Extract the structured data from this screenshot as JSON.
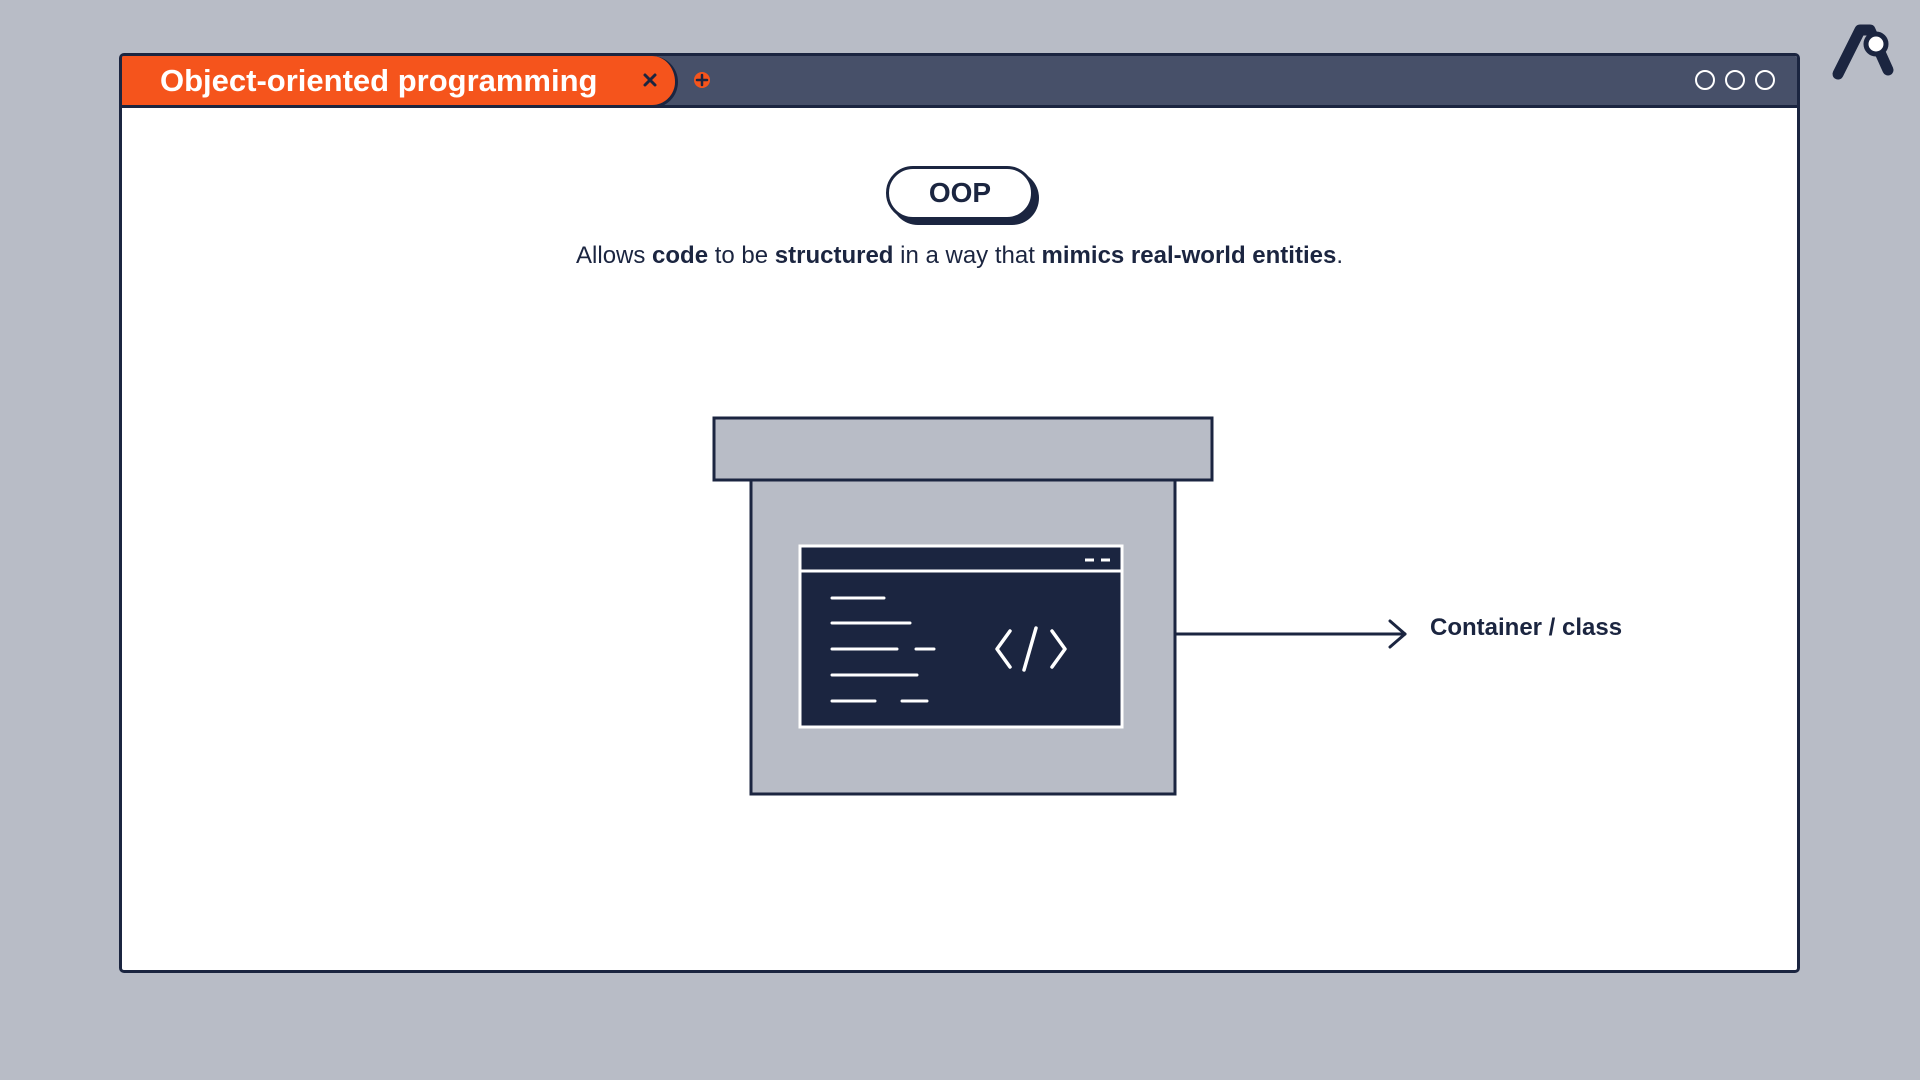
{
  "tab": {
    "title": "Object-oriented programming"
  },
  "badge": {
    "label": "OOP"
  },
  "subtitle": {
    "part1": "Allows ",
    "bold1": "code",
    "part2": " to be ",
    "bold2": "structured",
    "part3": " in a way that ",
    "bold3": "mimics real-world entities",
    "part4": "."
  },
  "diagram": {
    "arrow_label": "Container / class"
  },
  "colors": {
    "background": "#b8bcc6",
    "titlebar": "#475069",
    "tab_accent": "#f5541c",
    "ink": "#1b2540",
    "box_fill": "#b8bcc6"
  },
  "icons": {
    "logo": "brand-logo-icon",
    "close": "close-icon",
    "add": "plus-icon",
    "window_controls": [
      "circle-icon",
      "circle-icon",
      "circle-icon"
    ],
    "code": "code-brackets-icon",
    "arrow": "arrow-right-icon"
  }
}
